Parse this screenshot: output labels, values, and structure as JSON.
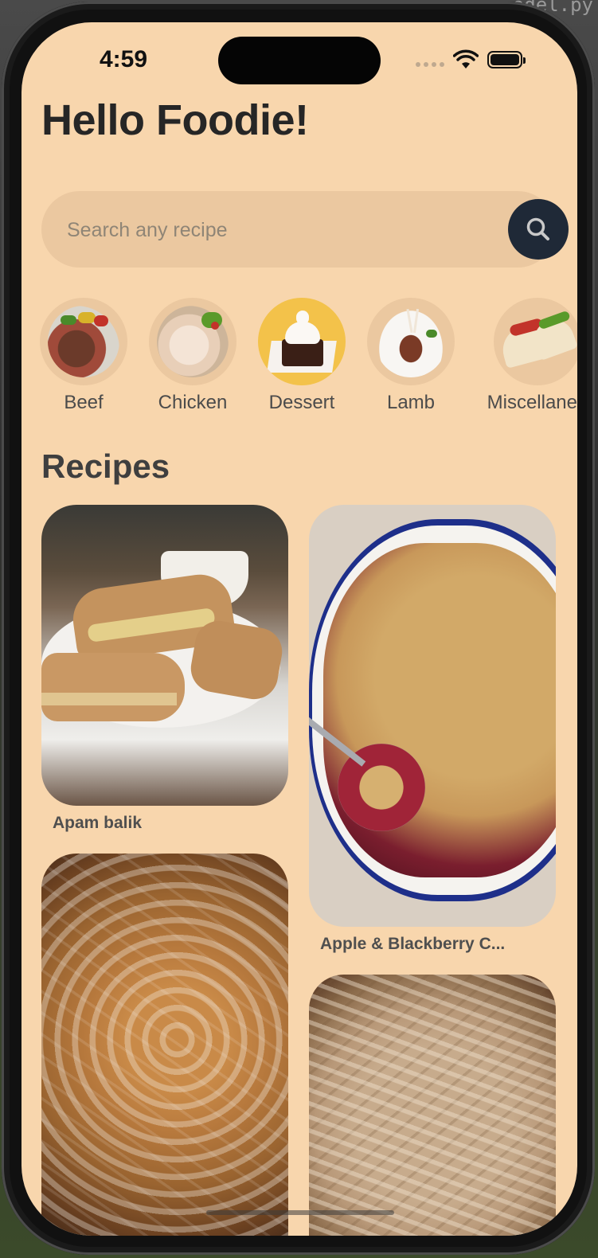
{
  "corner_text": "odel.py",
  "status_bar": {
    "time": "4:59"
  },
  "header": {
    "greeting": "Hello Foodie!"
  },
  "search": {
    "placeholder": "Search any recipe",
    "icon": "search-icon"
  },
  "categories": [
    {
      "label": "Beef",
      "selected": false
    },
    {
      "label": "Chicken",
      "selected": false
    },
    {
      "label": "Dessert",
      "selected": true
    },
    {
      "label": "Lamb",
      "selected": false
    },
    {
      "label": "Miscellaneo",
      "selected": false
    }
  ],
  "recipes_section": {
    "title": "Recipes",
    "items": [
      {
        "name": "Apam balik"
      },
      {
        "name": "Apple & Blackberry C..."
      },
      {
        "name": ""
      },
      {
        "name": ""
      }
    ]
  },
  "colors": {
    "background": "#f8d6ad",
    "search_bg": "#ebc8a0",
    "search_button": "#1f2937",
    "active_category": "#f3c24a",
    "heading": "#262626"
  }
}
